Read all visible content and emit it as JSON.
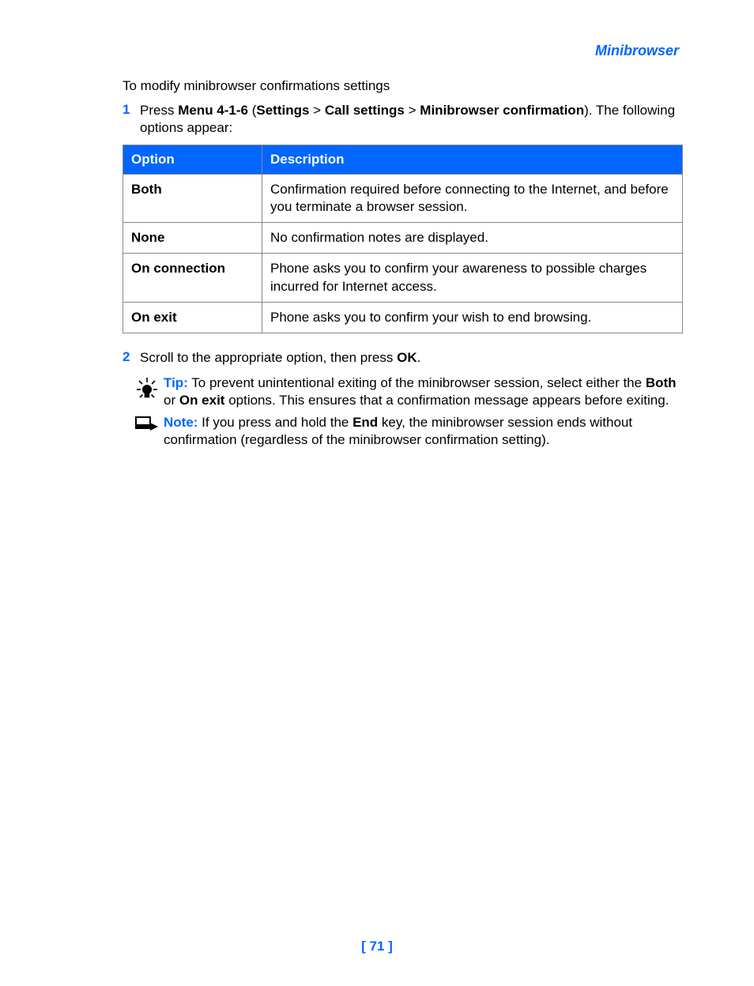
{
  "header": "Minibrowser",
  "intro": "To modify minibrowser confirmations settings",
  "step1": {
    "num": "1",
    "prefix": "Press ",
    "menu": "Menu 4-1-6",
    "paren_open": " (",
    "bc1": "Settings",
    "sep1": " > ",
    "bc2": "Call settings",
    "sep2": " > ",
    "bc3": "Minibrowser confirmation",
    "paren_close": "). The following options appear:"
  },
  "table": {
    "h1": "Option",
    "h2": "Description",
    "rows": [
      {
        "opt": "Both",
        "desc": "Confirmation required before connecting to the Internet, and before you terminate a browser session."
      },
      {
        "opt": "None",
        "desc": "No confirmation notes are displayed."
      },
      {
        "opt": "On connection",
        "desc": "Phone asks you to confirm your awareness to possible charges incurred for Internet access."
      },
      {
        "opt": "On exit",
        "desc": "Phone asks you to confirm your wish to end browsing."
      }
    ]
  },
  "step2": {
    "num": "2",
    "prefix": "Scroll to the appropriate option, then press ",
    "ok": "OK",
    "suffix": "."
  },
  "tip": {
    "label": "Tip:",
    "t1": " To prevent unintentional exiting of the minibrowser session, select either the ",
    "b1": "Both",
    "t2": " or ",
    "b2": "On exit",
    "t3": " options. This ensures that a confirmation message appears before exiting."
  },
  "note": {
    "label": "Note:",
    "t1": " If you press and hold the ",
    "b1": "End",
    "t2": " key, the minibrowser session ends without confirmation (regardless of the minibrowser confirmation setting)."
  },
  "pageNumber": "[ 71 ]"
}
